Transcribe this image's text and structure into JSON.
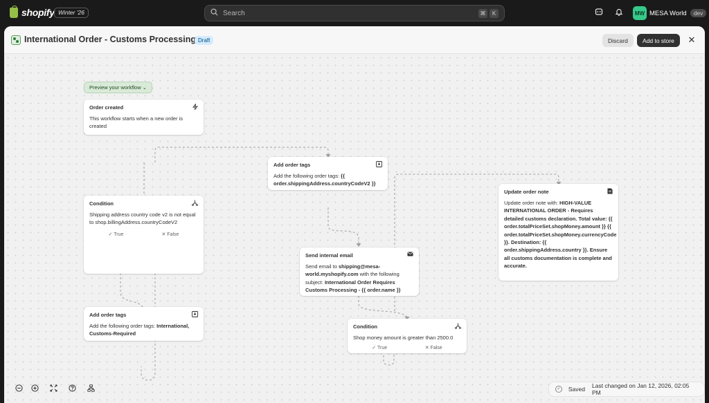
{
  "topbar": {
    "logo_text": "shopify",
    "season_badge": "Winter '26",
    "search_placeholder": "Search",
    "search_shortcut": [
      "⌘",
      "K"
    ],
    "icons": [
      "search-icon",
      "pos-icon",
      "bell-icon"
    ],
    "store_initials": "MW",
    "store_name": "MESA World",
    "store_badge": "dev"
  },
  "header": {
    "title": "International Order - Customs Processing",
    "status_badge": "Draft",
    "discard_label": "Discard",
    "add_label": "Add to store",
    "close_icon": "close-icon"
  },
  "canvas": {
    "preview_label": "Preview your workflow ⌄",
    "nodes": [
      {
        "title": "Order created",
        "icon": "lightning-icon",
        "description": "This workflow starts when a new order is created"
      },
      {
        "title": "Condition",
        "icon": "branch-icon",
        "description": "Shipping address country code v2 is not equal to shop.billingAddress.countryCodeV2",
        "true_label": "✓ True",
        "false_label": "✕ False"
      },
      {
        "title": "Add order tags",
        "icon": "tag-download-icon",
        "description_prefix": "Add the following order tags: ",
        "description_bold": "International, Customs-Required"
      },
      {
        "title": "Add order tags",
        "icon": "tag-download-icon",
        "description_prefix": "Add the following order tags: ",
        "description_bold": "{{ order.shippingAddress.countryCodeV2 }}"
      },
      {
        "title": "Send internal email",
        "icon": "mail-icon",
        "description_prefix": "Send email to ",
        "description_email": "shipping@mesa-world.myshopify.com",
        "description_middle": " with the following subject: ",
        "description_subject": "International Order Requires Customs Processing - {{ order.name }}"
      },
      {
        "title": "Condition",
        "icon": "branch-icon",
        "description": "Shop money amount is greater than 2500.0",
        "true_label": "✓ True",
        "false_label": "✕ False"
      },
      {
        "title": "Update order note",
        "icon": "note-icon",
        "description_prefix": "Update order note with: ",
        "description_bold": "HIGH-VALUE INTERNATIONAL ORDER - Requires detailed customs declaration. Total value: {{ order.totalPriceSet.shopMoney.amount }} {{ order.totalPriceSet.shopMoney.currencyCode }}. Destination: {{ order.shippingAddress.country }}. Ensure all customs documentation is complete and accurate."
      }
    ]
  },
  "footer": {
    "tools": [
      "zoom-out-icon",
      "zoom-in-icon",
      "fit-view-icon",
      "help-icon",
      "layout-icon"
    ],
    "saved_label": "Saved",
    "last_changed": "Last changed on Jan 12, 2026, 02:05 PM"
  },
  "colors": {
    "topbar_bg": "#1a1a1a",
    "canvas_bg": "#f1f1f1",
    "draft_badge_bg": "#d5ebff",
    "avatar_bg": "#36c98a",
    "primary_button": "#303030"
  }
}
